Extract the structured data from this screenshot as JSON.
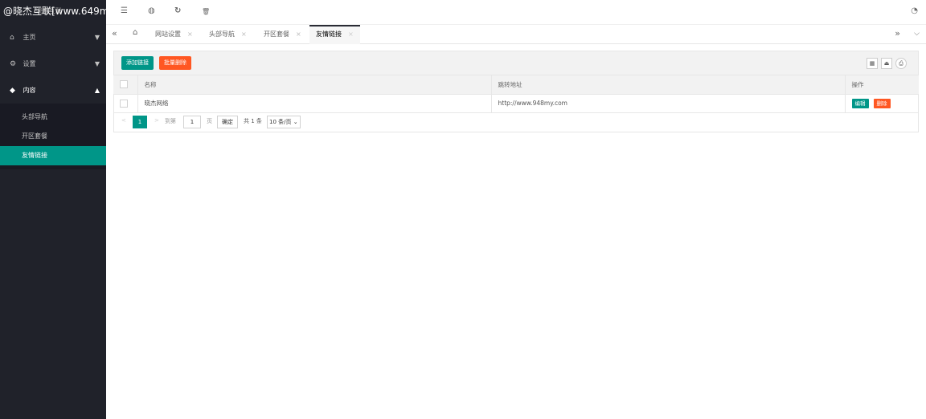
{
  "watermark": "@晓杰互联[www.649m",
  "logo_text": "晓杰互联",
  "sidebar": {
    "items": [
      {
        "label": "主页",
        "icon": "home-icon"
      },
      {
        "label": "设置",
        "icon": "gear-icon"
      },
      {
        "label": "内容",
        "icon": "diamond-icon"
      }
    ],
    "sub_items": [
      {
        "label": "头部导航"
      },
      {
        "label": "开区套餐"
      },
      {
        "label": "友情链接"
      }
    ]
  },
  "header": {
    "icons": [
      "menu-indent-icon",
      "globe-icon",
      "refresh-icon",
      "trash-icon",
      "theme-icon"
    ]
  },
  "tabs": {
    "items": [
      {
        "label": "网站设置"
      },
      {
        "label": "头部导航"
      },
      {
        "label": "开区套餐"
      },
      {
        "label": "友情链接"
      }
    ],
    "close": "×"
  },
  "toolbar": {
    "add_label": "添加链接",
    "batch_delete_label": "批量删除"
  },
  "table": {
    "headers": [
      "名称",
      "跳转地址",
      "操作"
    ],
    "rows": [
      {
        "name": "晓杰网络",
        "url": "http://www.948my.com",
        "edit": "编辑",
        "delete": "删除"
      }
    ]
  },
  "pager": {
    "prev": "<",
    "current": "1",
    "next": ">",
    "goto_label": "到第",
    "page_input": "1",
    "page_unit": "页",
    "confirm": "确定",
    "total": "共 1 条",
    "page_size": "10 条/页"
  },
  "colors": {
    "sidebar_bg": "#20222a",
    "accent": "#009688",
    "danger": "#ff5722"
  }
}
